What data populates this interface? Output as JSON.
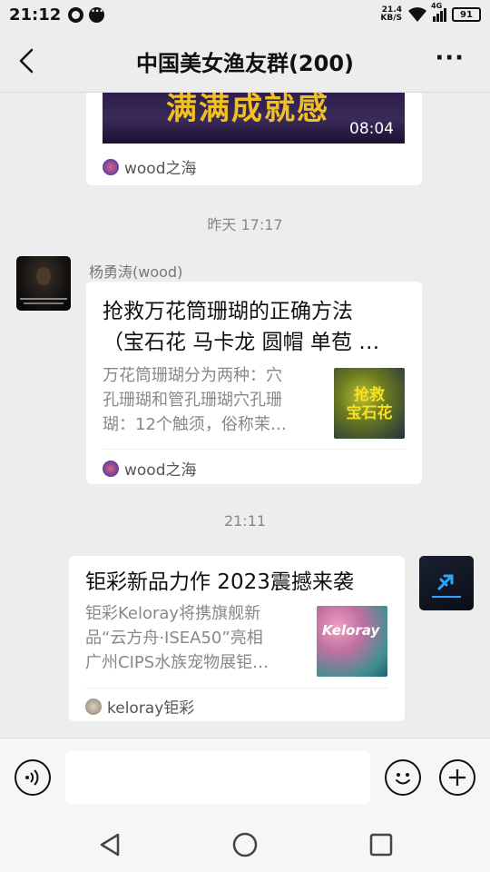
{
  "status_bar": {
    "time": "21:12",
    "net_speed_value": "21.4",
    "net_speed_unit": "KB/S",
    "signal_label": "4G",
    "battery": "91"
  },
  "header": {
    "title": "中国美女渔友群(200)",
    "more_label": "···"
  },
  "messages": {
    "video_card": {
      "overlay_text": "满满成就感",
      "duration": "08:04",
      "source": "wood之海"
    },
    "timestamp_1": "昨天 17:17",
    "article_1": {
      "sender": "杨勇涛(wood)",
      "title": "抢救万花筒珊瑚的正确方法（宝石花 马卡龙 圆帽 单苞 …",
      "title_line1": "抢救万花筒珊瑚的正确方法",
      "title_line2": "（宝石花 马卡龙 圆帽 单苞 …",
      "desc_line1": "万花筒珊瑚分为两种：穴",
      "desc_line2": "孔珊瑚和管孔珊瑚穴孔珊",
      "desc_line3": "瑚：12个触须，俗称茉…",
      "thumb_text_1": "抢救",
      "thumb_text_2": "宝石花",
      "source": "wood之海"
    },
    "timestamp_2": "21:11",
    "article_2": {
      "title": "钜彩新品力作 2023震撼来袭",
      "desc_line1": "钜彩Keloray将携旗舰新",
      "desc_line2": "品“云方舟·ISEA50”亮相",
      "desc_line3": "广州CIPS水族宠物展钜…",
      "thumb_text": "Keloray",
      "source": "keloray钜彩"
    }
  },
  "input": {
    "placeholder": ""
  },
  "colors": {
    "background": "#ededed",
    "card": "#ffffff",
    "text_primary": "#111111",
    "text_secondary": "#888888"
  }
}
